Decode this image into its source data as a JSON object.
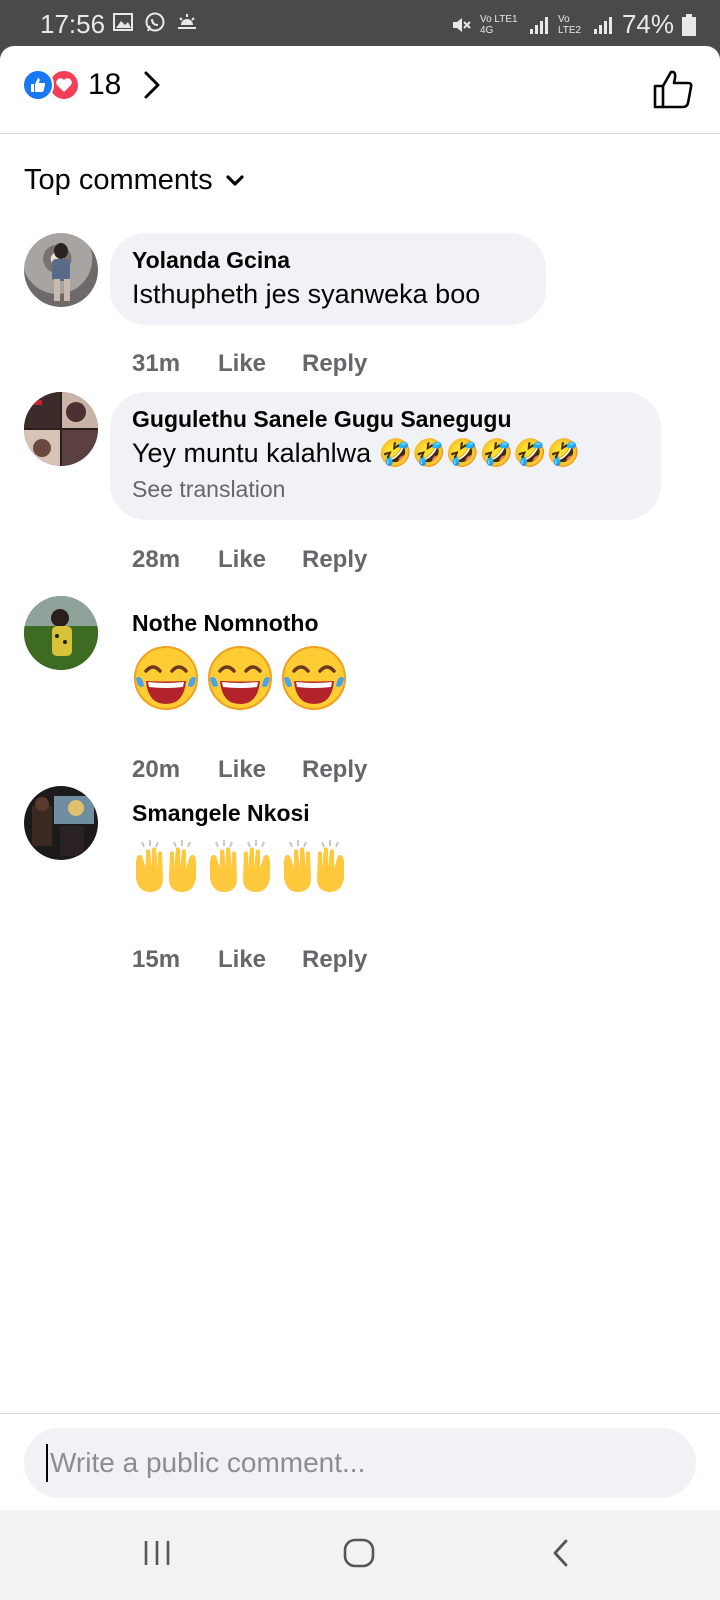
{
  "status_bar": {
    "time": "17:56",
    "network_1": "Vo LTE1 4G",
    "network_2": "Vo LTE2",
    "battery": "74%"
  },
  "header": {
    "reaction_count": "18",
    "reactions": [
      "like-icon",
      "love-icon"
    ]
  },
  "sort": {
    "label": "Top comments"
  },
  "comments": [
    {
      "author": "Yolanda Gcina",
      "text": "Isthupheth jes syanweka boo",
      "time": "31m",
      "like": "Like",
      "reply": "Reply"
    },
    {
      "author": "Gugulethu Sanele Gugu Sanegugu",
      "text": "Yey muntu kalahlwa 🤣🤣🤣🤣🤣🤣",
      "translation": "See translation",
      "time": "28m",
      "like": "Like",
      "reply": "Reply"
    },
    {
      "author": "Nothe Nomnotho",
      "emoji": "😂😂😂",
      "time": "20m",
      "like": "Like",
      "reply": "Reply"
    },
    {
      "author": "Smangele Nkosi",
      "emoji": "🙌🙌🙌",
      "time": "15m",
      "like": "Like",
      "reply": "Reply"
    }
  ],
  "composer": {
    "placeholder": "Write a public comment..."
  },
  "colors": {
    "like_blue": "#1877f2",
    "love_red": "#f33e58",
    "bubble_bg": "#f0f2f5",
    "secondary_text": "#65676b"
  }
}
